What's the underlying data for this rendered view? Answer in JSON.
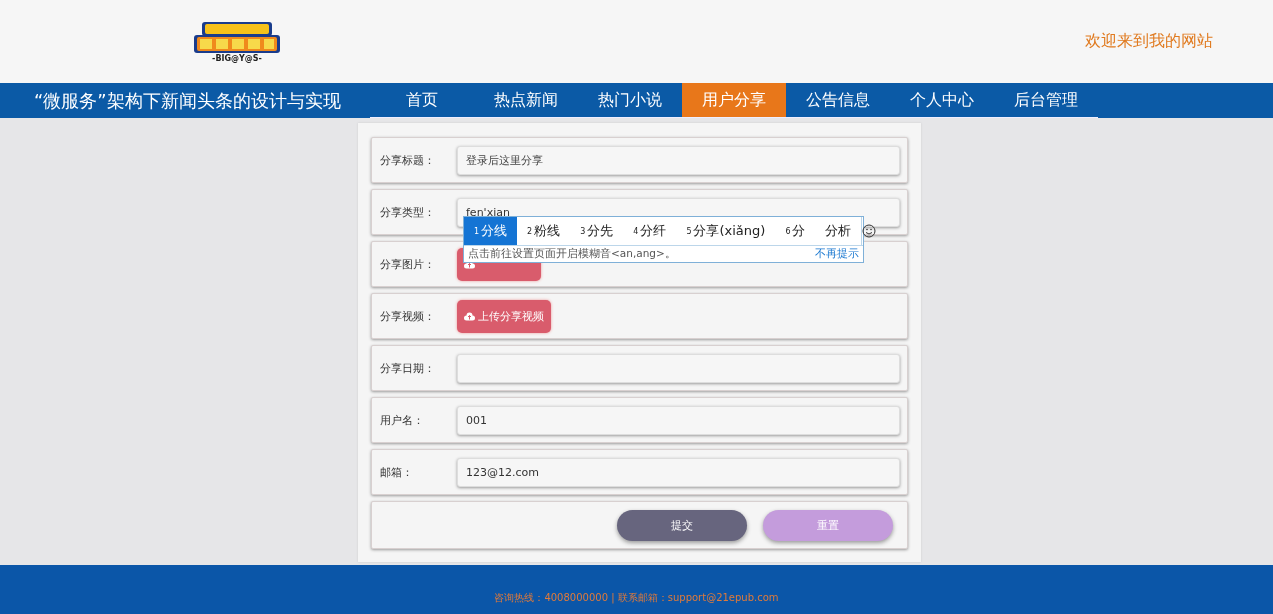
{
  "header": {
    "logo_text": "-BIG@Y@S-",
    "greeting": "欢迎来到我的网站"
  },
  "nav": {
    "site_title": "“微服务”架构下新闻头条的设计与实现",
    "items": [
      {
        "label": "首页",
        "selected": false
      },
      {
        "label": "热点新闻",
        "selected": false
      },
      {
        "label": "热门小说",
        "selected": false
      },
      {
        "label": "用户分享",
        "selected": true
      },
      {
        "label": "公告信息",
        "selected": false
      },
      {
        "label": "个人中心",
        "selected": false
      },
      {
        "label": "后台管理",
        "selected": false
      }
    ]
  },
  "form": {
    "rows": [
      {
        "kind": "field",
        "label": "分享标题：",
        "placeholder": "登录后这里分享"
      },
      {
        "kind": "field",
        "label": "分享类型：",
        "value": "fen'xian"
      },
      {
        "kind": "upload",
        "label": "分享图片："
      },
      {
        "kind": "upload",
        "label": "分享视频：",
        "button": "上传分享视频"
      },
      {
        "kind": "field",
        "label": "分享日期："
      },
      {
        "kind": "field",
        "label": "用户名：",
        "value": "001"
      },
      {
        "kind": "field",
        "label": "邮箱：",
        "value": "123@12.com"
      }
    ],
    "buttons": [
      {
        "kind": "submit",
        "label": "提交"
      },
      {
        "kind": "reset",
        "label": "重置"
      }
    ]
  },
  "ime_popup": {
    "candidates": [
      {
        "number": "1",
        "text": "分线",
        "selected": true
      },
      {
        "number": "2",
        "text": "粉线",
        "selected": false
      },
      {
        "number": "3",
        "text": "分先",
        "selected": false
      },
      {
        "number": "4",
        "text": "分纤",
        "selected": false
      },
      {
        "number": "5",
        "text": "分享(xiǎng)",
        "selected": false
      },
      {
        "number": "6",
        "text": "分",
        "selected": false
      },
      {
        "text": "分析",
        "selected": false
      }
    ],
    "hint": "点击前往设置页面开启模糊音<an,ang>。",
    "dismiss": "不再提示"
  },
  "footer": {
    "text": "咨询热线：4008000000 | 联系邮箱：support@21epub.com"
  }
}
